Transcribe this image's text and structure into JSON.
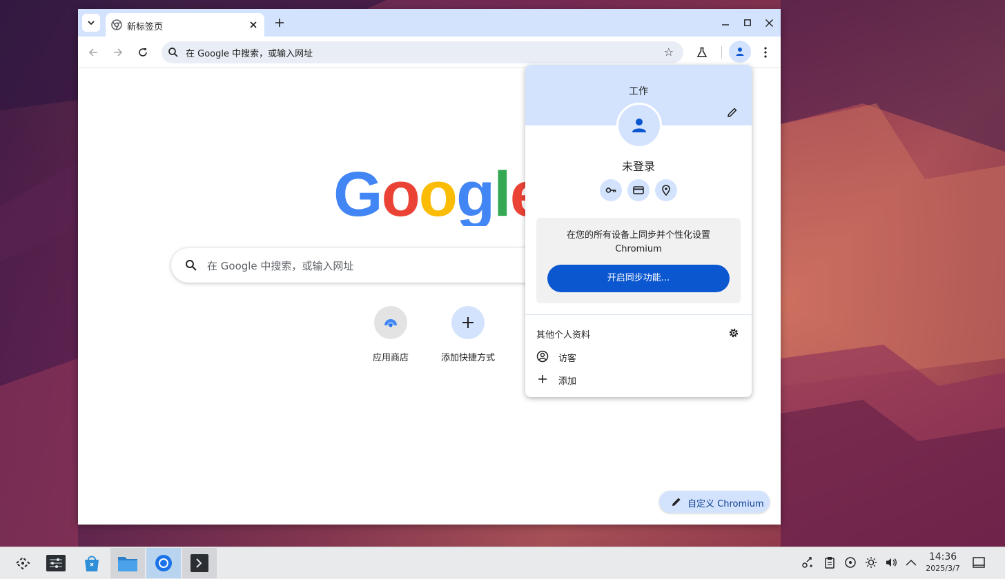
{
  "browser": {
    "tab": {
      "title": "新标签页"
    },
    "omnibox": {
      "placeholder": "在 Google 中搜索，或输入网址"
    }
  },
  "ntp": {
    "search_placeholder": "在 Google 中搜索，或输入网址",
    "shortcuts": [
      {
        "label": "应用商店",
        "icon": "web-store-icon"
      },
      {
        "label": "添加快捷方式",
        "icon": "plus-icon"
      }
    ],
    "customize_label": "自定义 Chromium"
  },
  "profile_menu": {
    "profile_title": "工作",
    "status": "未登录",
    "quick_actions": [
      "key-icon",
      "credit-card-icon",
      "location-pin-icon"
    ],
    "sync_text": "在您的所有设备上同步并个性化设置 Chromium",
    "sync_button": "开启同步功能...",
    "other_profiles_label": "其他个人资料",
    "items": [
      {
        "label": "访客",
        "icon": "guest-icon"
      },
      {
        "label": "添加",
        "icon": "plus-icon"
      }
    ]
  },
  "taskbar": {
    "apps": [
      "app-launcher",
      "system-settings",
      "discover",
      "file-manager",
      "chromium",
      "terminal"
    ],
    "clock_time": "14:36",
    "clock_date": "2025/3/7"
  },
  "colors": {
    "accent": "#0b57d0",
    "tint": "#d3e3fd",
    "google_blue": "#4285f4",
    "google_red": "#ea4335",
    "google_yellow": "#fbbc05",
    "google_green": "#34a853"
  }
}
